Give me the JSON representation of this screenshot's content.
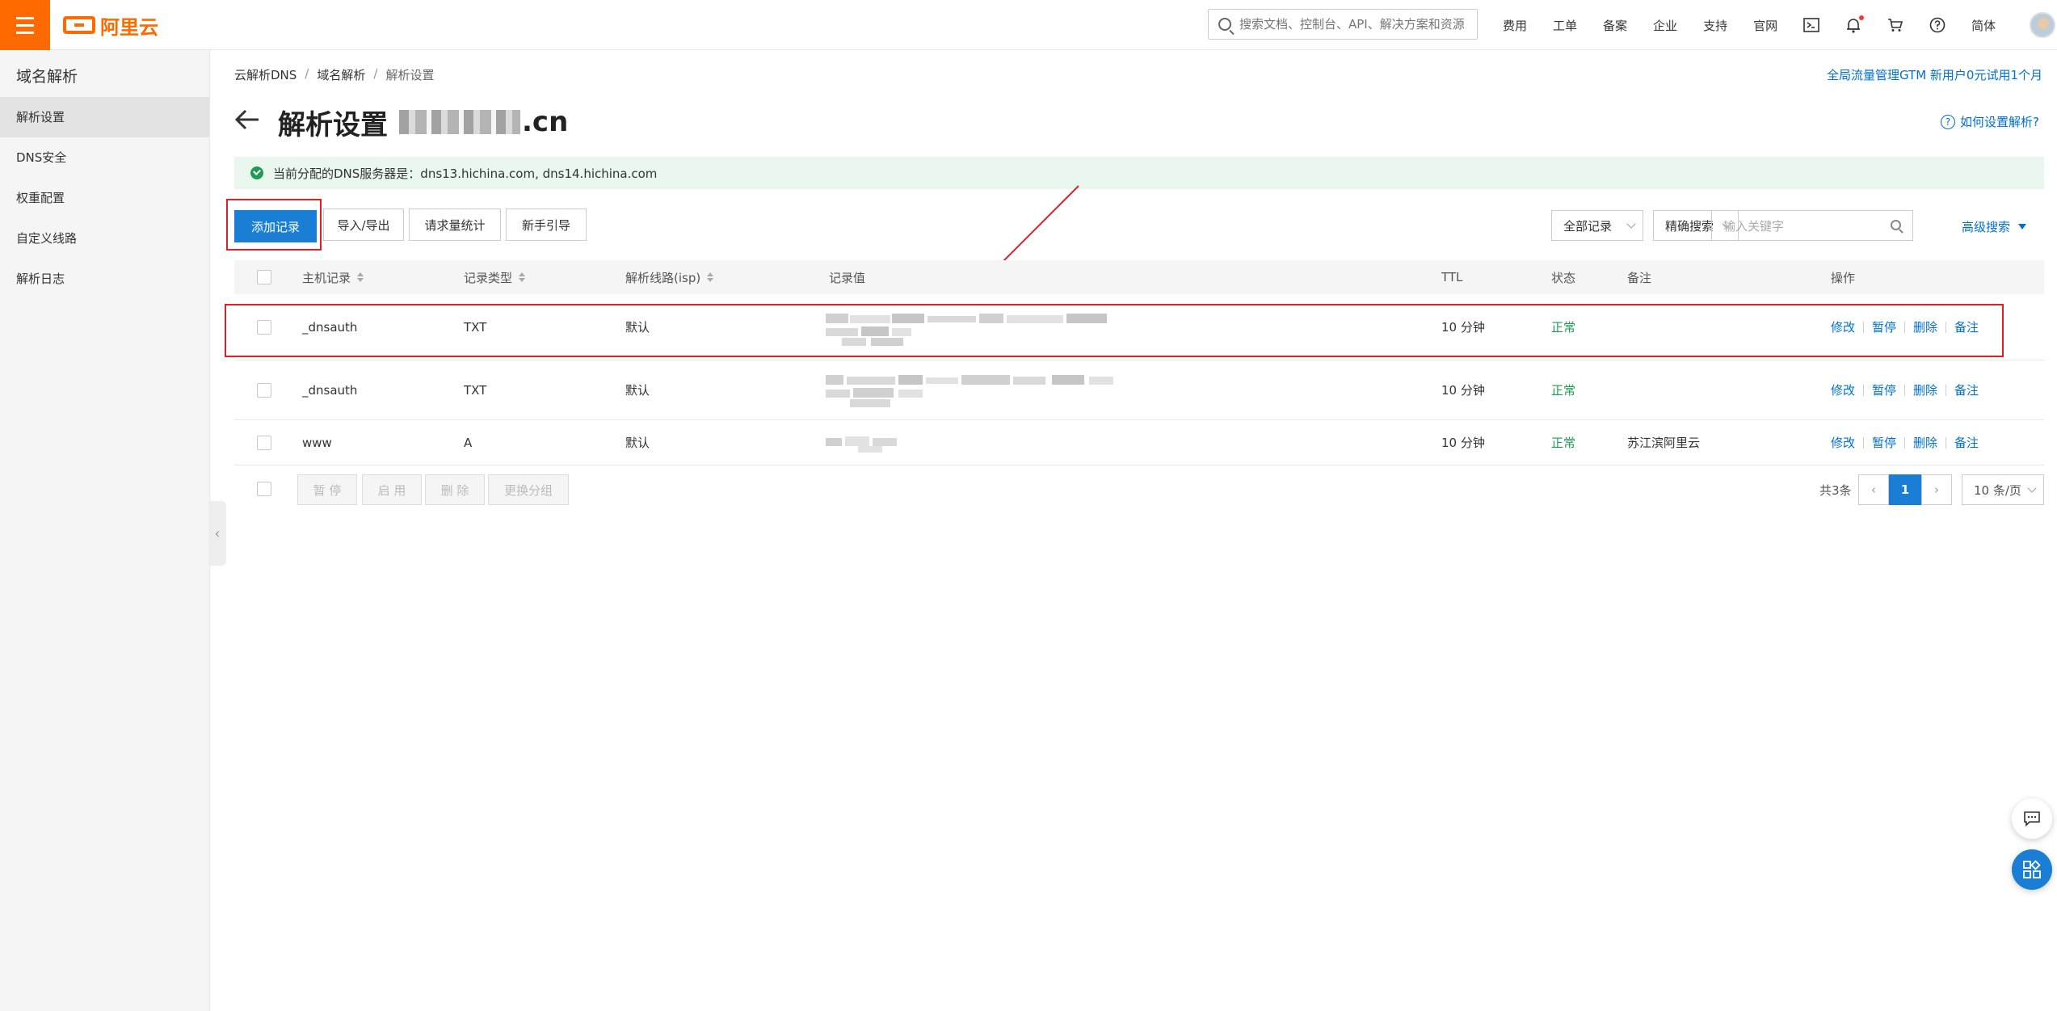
{
  "topbar": {
    "brand": "阿里云",
    "search_placeholder": "搜索文档、控制台、API、解决方案和资源",
    "links": [
      "费用",
      "工单",
      "备案",
      "企业",
      "支持",
      "官网"
    ],
    "lang": "简体"
  },
  "sidebar": {
    "title": "域名解析",
    "items": [
      {
        "label": "解析设置",
        "active": true
      },
      {
        "label": "DNS安全"
      },
      {
        "label": "权重配置"
      },
      {
        "label": "自定义线路"
      },
      {
        "label": "解析日志"
      }
    ]
  },
  "breadcrumb": [
    "云解析DNS",
    "域名解析",
    "解析设置"
  ],
  "promo": "全局流量管理GTM 新用户0元试用1个月",
  "page": {
    "title": "解析设置",
    "domain_suffix": ".cn",
    "help": "如何设置解析?"
  },
  "dns_notice": "当前分配的DNS服务器是：dns13.hichina.com, dns14.hichina.com",
  "toolbar": {
    "add": "添加记录",
    "import_export": "导入/导出",
    "stats": "请求量统计",
    "guide": "新手引导",
    "filter": "全部记录",
    "search_mode": "精确搜索",
    "keyword_placeholder": "输入关键字",
    "advanced": "高级搜索"
  },
  "table": {
    "headers": {
      "host": "主机记录",
      "type": "记录类型",
      "line": "解析线路(isp)",
      "value": "记录值",
      "ttl": "TTL",
      "status": "状态",
      "remark": "备注",
      "ops": "操作"
    },
    "rows": [
      {
        "host": "_dnsauth",
        "type": "TXT",
        "line": "默认",
        "ttl": "10 分钟",
        "status": "正常",
        "remark": ""
      },
      {
        "host": "_dnsauth",
        "type": "TXT",
        "line": "默认",
        "ttl": "10 分钟",
        "status": "正常",
        "remark": ""
      },
      {
        "host": "www",
        "type": "A",
        "line": "默认",
        "ttl": "10 分钟",
        "status": "正常",
        "remark": "苏江滨阿里云"
      }
    ],
    "ops": [
      "修改",
      "暂停",
      "删除",
      "备注"
    ]
  },
  "footer": {
    "pause": "暂 停",
    "enable": "启 用",
    "delete": "删 除",
    "change_group": "更换分组",
    "total": "共3条",
    "current_page": "1",
    "per_page": "10 条/页"
  },
  "colors": {
    "brand": "#ff6a00",
    "primary": "#1a7fd4",
    "link": "#0070cc",
    "success": "#1e9c51",
    "highlight": "#e02020"
  }
}
